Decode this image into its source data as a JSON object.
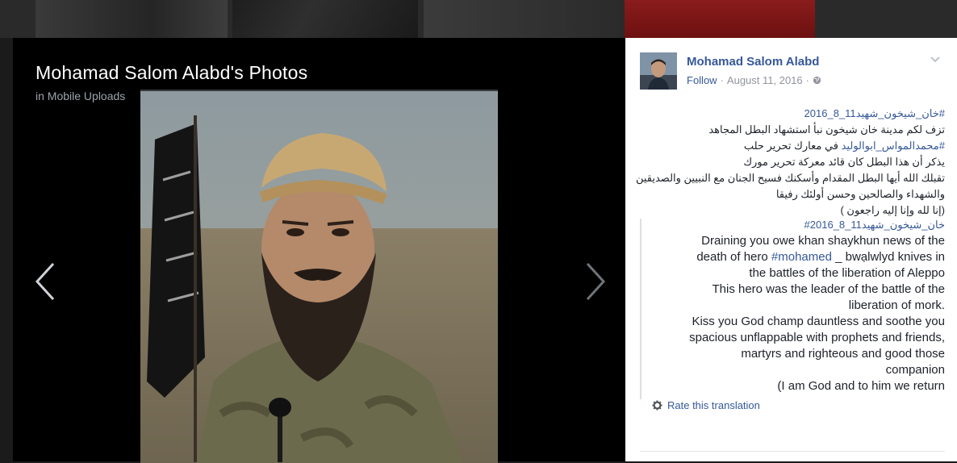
{
  "viewer": {
    "title": "Mohamad Salom Alabd's Photos",
    "album": "in Mobile Uploads",
    "prev_icon": "chevron-left-icon",
    "next_icon": "chevron-right-icon"
  },
  "post": {
    "author": "Mohamad Salom Alabd",
    "follow_label": "Follow",
    "separator": "·",
    "date": "August 11, 2016",
    "separator2": "·",
    "privacy_icon": "globe-icon",
    "options_icon": "chevron-down-icon",
    "original_lines": [
      {
        "tag": "#خان_شيخون_شهيد11_8_2016",
        "text": ""
      },
      {
        "tag": "",
        "text": "تزف لكم مدينة خان شيخون نبأ استشهاد البطل المجاهد"
      },
      {
        "tag": "#محمدالمواس_ابوالوليد",
        "text": " في معارك تحرير حلب"
      },
      {
        "tag": "",
        "text": "يذكر أن هذا البطل كان قائد معركة تحرير مورك"
      },
      {
        "tag": "",
        "text": "تقبلك الله أيها البطل المقدام وأسكنك فسيح الجنان مع النبيين والصديقين"
      },
      {
        "tag": "",
        "text": "والشهداء والصالحين وحسن أولئك رفيقا"
      },
      {
        "tag": "",
        "text": "(إنا لله وإنا إليه راجعون )"
      }
    ],
    "translation": {
      "tag": "#خان_شيخون_شهيد11_8_2016",
      "line1": "Draining you owe khan shaykhun news of the",
      "line2_pre": "death of hero ",
      "line2_tag": "#mohamed",
      "line2_post": " _ bwạlwlyd knives in",
      "line3": "the battles of the liberation of Aleppo",
      "line4": "This hero was the leader of the battle of the",
      "line5": "liberation of mork.",
      "line6": "Kiss you God champ dauntless and soothe you",
      "line7": "spacious unflappable with prophets and friends,",
      "line8": "martyrs and righteous and good those",
      "line9": "companion",
      "line10": "(I am God and to him we return",
      "rate_label": "Rate this translation",
      "rate_icon": "gear-icon"
    }
  },
  "colors": {
    "link": "#365899",
    "meta": "#90949c",
    "stage_bg": "#000000"
  }
}
